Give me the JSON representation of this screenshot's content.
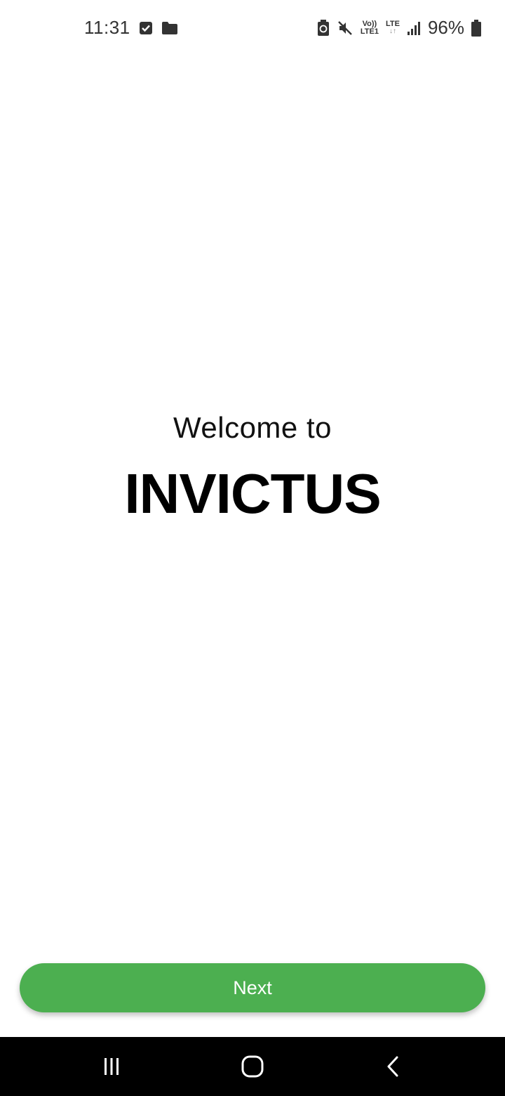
{
  "status_bar": {
    "time": "11:31",
    "network_top": "Vo))",
    "network_bottom": "LTE1",
    "lte_label": "LTE",
    "lte_arrows": "↓↑",
    "battery_percent": "96%",
    "icons": [
      "checkbox-icon",
      "folder-icon",
      "battery-saver-icon",
      "mute-icon",
      "signal-icon",
      "battery-icon"
    ]
  },
  "welcome": {
    "subtitle": "Welcome to",
    "title": "INVICTUS"
  },
  "actions": {
    "next_label": "Next"
  },
  "nav_bar": {
    "icons": [
      "recent-apps-icon",
      "home-icon",
      "back-icon"
    ]
  },
  "colors": {
    "accent": "#4caf50",
    "background": "#ffffff",
    "nav_background": "#000000"
  }
}
